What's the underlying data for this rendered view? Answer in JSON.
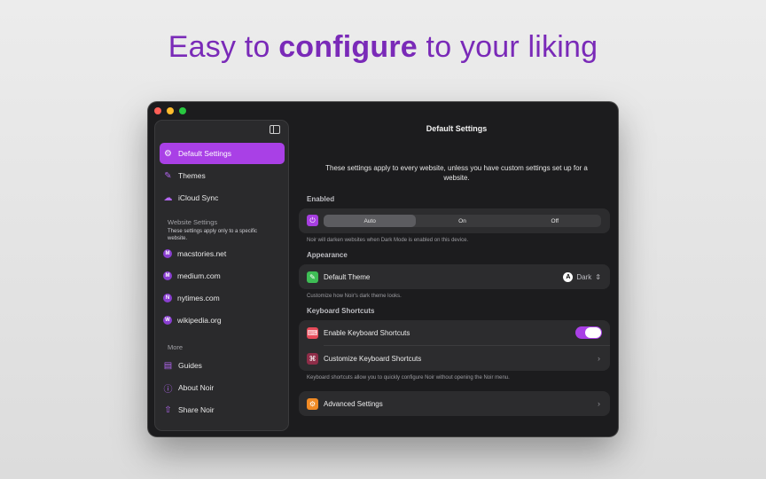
{
  "headline": {
    "prefix": "Easy to ",
    "bold": "configure",
    "suffix": " to your liking"
  },
  "sidebar": {
    "items": [
      {
        "label": "Default Settings",
        "icon": "gear-icon"
      },
      {
        "label": "Themes",
        "icon": "paintbrush-icon"
      },
      {
        "label": "iCloud Sync",
        "icon": "cloud-icon"
      }
    ],
    "website_settings": {
      "label": "Website Settings",
      "subtitle": "These settings apply only to a specific website.",
      "sites": [
        {
          "label": "macstories.net",
          "initial": "M"
        },
        {
          "label": "medium.com",
          "initial": "M"
        },
        {
          "label": "nytimes.com",
          "initial": "N"
        },
        {
          "label": "wikipedia.org",
          "initial": "W"
        }
      ]
    },
    "more": {
      "label": "More",
      "items": [
        {
          "label": "Guides",
          "icon": "book-icon"
        },
        {
          "label": "About Noir",
          "icon": "info-icon"
        },
        {
          "label": "Share Noir",
          "icon": "share-icon"
        }
      ]
    }
  },
  "main": {
    "title": "Default Settings",
    "intro": "These settings apply to every website, unless you have custom settings set up for a website.",
    "enabled": {
      "label": "Enabled",
      "options": [
        "Auto",
        "On",
        "Off"
      ],
      "selected": "Auto",
      "footnote": "Noir will darken websites when Dark Mode is enabled on this device."
    },
    "appearance": {
      "label": "Appearance",
      "row_label": "Default Theme",
      "value": "Dark",
      "badge": "A",
      "footnote": "Customize how Noir's dark theme looks."
    },
    "keyboard": {
      "label": "Keyboard Shortcuts",
      "enable_label": "Enable Keyboard Shortcuts",
      "enabled": true,
      "customize_label": "Customize Keyboard Shortcuts",
      "footnote": "Keyboard shortcuts allow you to quickly configure Noir without opening the Noir menu."
    },
    "advanced": {
      "label": "Advanced Settings"
    }
  },
  "colors": {
    "accent": "#a940e6",
    "headline": "#7a2ab8",
    "window_bg": "#1c1c1e"
  }
}
